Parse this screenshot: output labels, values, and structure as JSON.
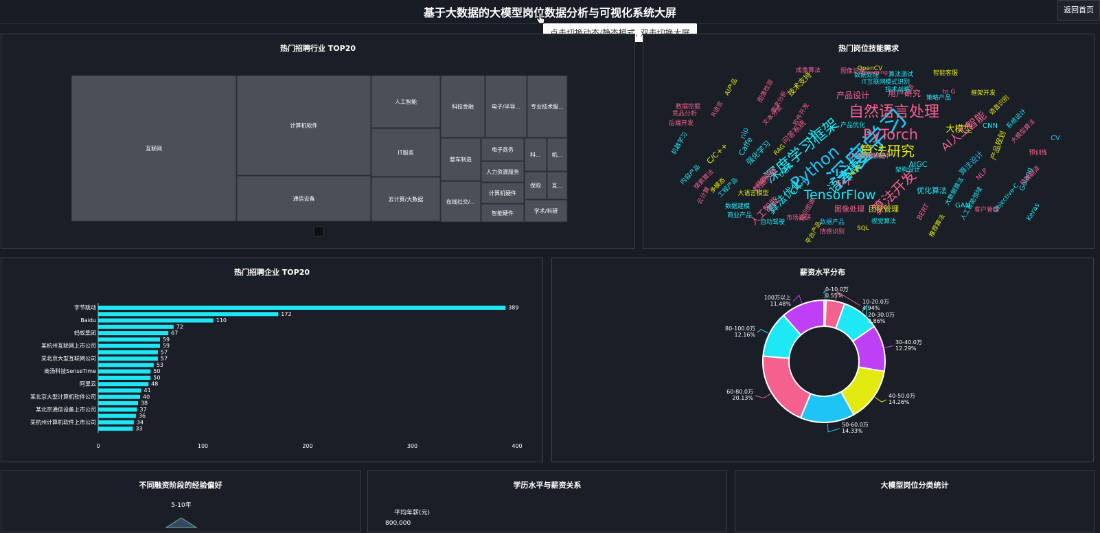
{
  "header": {
    "title": "基于大数据的大模型岗位数据分析与可视化系统大屏",
    "home_label": "返回首页",
    "tooltip": "点击切换动态/静态模式, 双击切换大屏"
  },
  "panels": {
    "industry": "热门招聘行业 TOP20",
    "skills": "热门岗位技能需求",
    "companies": "热门招聘企业 TOP20",
    "salary": "薪资水平分布",
    "funding": "不同融资阶段的经验偏好",
    "education": "学历水平与薪资关系",
    "category": "大模型岗位分类统计"
  },
  "colors": {
    "bar": "#1fe6f5",
    "tile": "#4a4f58",
    "accent1": "#f5618f",
    "accent2": "#1ee8f5",
    "accent3": "#be3ff5",
    "accent4": "#e3ea10",
    "accent5": "#1ec4f5"
  },
  "chart_data": [
    {
      "type": "treemap",
      "title": "热门招聘行业 TOP20",
      "items": [
        "互联网",
        "计算机软件",
        "通信设备",
        "人工智能",
        "IT服务",
        "云计算/大数据",
        "科技金融",
        "整车制造",
        "在线社交/...",
        "电子/半导...",
        "专业技术服...",
        "电子商务",
        "人力资源服务",
        "计算机硬件",
        "智能硬件",
        "科...",
        "机...",
        "保险",
        "互...",
        "学术/科研"
      ]
    },
    {
      "type": "wordcloud",
      "title": "热门岗位技能需求",
      "words": [
        "深度学习",
        "自然语言处理",
        "PyTorch",
        "Python",
        "深度学习框架",
        "语言模型",
        "算法研究",
        "TensorFlow",
        "算法开发",
        "算法优化",
        "人工智能",
        "大模型",
        "AI人工智能",
        "产品设计",
        "用户研究",
        "C++",
        "Java",
        "GPT",
        "AIGC",
        "优化算法",
        "NLP",
        "产品规划",
        "算法设计",
        "CV",
        "Golang",
        "Keras",
        "GAN",
        "BERT",
        "CNN",
        "SQL",
        "图像处理",
        "团队管理",
        "数据分析",
        "视觉算法",
        "推荐算法",
        "机器学习",
        "强化学习",
        "IT互联网",
        "技术支持",
        "文本分类",
        "图像识别",
        "OpenCV",
        "数据处理",
        "算法测试",
        "智能客服",
        "模式识别",
        "技术战略",
        "策略产品",
        "框架开发",
        "语音识别",
        "系统设计",
        "大模型算法",
        "预训练",
        "机器翻译",
        "客户管理",
        "Objective-C",
        "人工智能领域",
        "大数据算法",
        "数据产品",
        "情感识别",
        "平台产品",
        "自动驾驶",
        "市场调研",
        "知识图谱",
        "商业产品",
        "数据建模",
        "大语言模型",
        "工程产品",
        "云计算",
        "内容产品",
        "搜索算法",
        "多模态",
        "机器学习",
        "后端开发",
        "竞品分析",
        "数据挖掘",
        "AI产品",
        "R语言",
        "图像检测",
        "需求分析",
        "软件开发",
        "问答系统",
        "RAG",
        "LLM",
        "C语言",
        "Caffe",
        "nlp",
        "C/C++",
        "产品优化",
        "架构设计",
        "to B",
        "to G",
        "Q-learning",
        "成像算法",
        "大数据领域",
        "IT/互联网/软件"
      ]
    },
    {
      "type": "bar",
      "title": "热门招聘企业 TOP20",
      "categories": [
        "字节跳动",
        "",
        "Baidu",
        "",
        "蚂蚁集团",
        "",
        "某杭州互联网上市公司",
        "",
        "某北京大型互联网公司",
        "",
        "商汤科技SenseTime",
        "",
        "阿里云",
        "",
        "某北京大型计算机软件公司",
        "",
        "某北京通信设备上市公司",
        "",
        "某杭州计算机软件上市公司",
        ""
      ],
      "values": [
        389,
        172,
        110,
        72,
        67,
        59,
        59,
        57,
        57,
        53,
        50,
        50,
        48,
        41,
        40,
        38,
        37,
        36,
        34,
        33
      ],
      "xlim": [
        0,
        400
      ],
      "xticks": [
        "0",
        "100",
        "200",
        "300",
        "400"
      ]
    },
    {
      "type": "pie",
      "title": "薪资水平分布",
      "slices": [
        {
          "label": "0-10.0万",
          "pct": "0.55%",
          "value": 0.55,
          "color": "#1ec4f5"
        },
        {
          "label": "10-20.0万",
          "pct": "4.94%",
          "value": 4.94,
          "color": "#f5618f"
        },
        {
          "label": "20-30.0万",
          "pct": "9.86%",
          "value": 9.86,
          "color": "#1ee8f5"
        },
        {
          "label": "30-40.0万",
          "pct": "12.29%",
          "value": 12.29,
          "color": "#be3ff5"
        },
        {
          "label": "40-50.0万",
          "pct": "14.26%",
          "value": 14.26,
          "color": "#e3ea10"
        },
        {
          "label": "50-60.0万",
          "pct": "14.33%",
          "value": 14.33,
          "color": "#1ec4f5"
        },
        {
          "label": "60-80.0万",
          "pct": "20.13%",
          "value": 20.13,
          "color": "#f5618f"
        },
        {
          "label": "80-100.0万",
          "pct": "12.16%",
          "value": 12.16,
          "color": "#1ee8f5"
        },
        {
          "label": "100万以上",
          "pct": "11.48%",
          "value": 11.48,
          "color": "#be3ff5"
        }
      ]
    },
    {
      "type": "radar",
      "title": "不同融资阶段的经验偏好",
      "indicator": "5-10年"
    },
    {
      "type": "bar",
      "title": "学历水平与薪资关系",
      "ylabel": "平均年薪(元)",
      "yticks": [
        "800,000"
      ]
    }
  ]
}
